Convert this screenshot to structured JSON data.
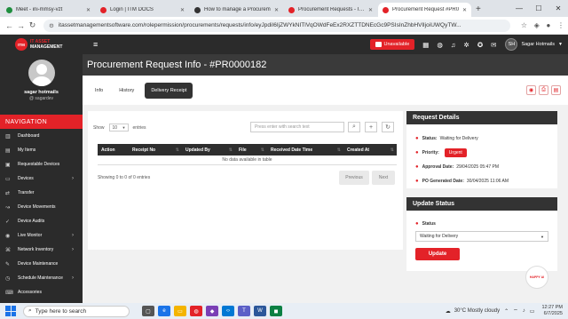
{
  "browser": {
    "tabs": [
      {
        "title": "Meet - ini-mmsy-vzt",
        "color": "#1e8e3e",
        "active": false
      },
      {
        "title": "Login | ITM DOCS",
        "color": "#e32228",
        "active": false
      },
      {
        "title": "How to manage a Procurem",
        "color": "#333333",
        "active": false
      },
      {
        "title": "Procurement Requests - ITM",
        "color": "#e32228",
        "active": false
      },
      {
        "title": "Procurement Request #PR0",
        "color": "#e32228",
        "active": true
      }
    ],
    "url": "itassetmanagementsoftware.com/rolepermission/procurements/requests/info/eyJpdiI6IjZWYkNITlVqOWdFeEx2RXZTTDNEcGc9PSIsInZhbHVlIjoiUWQyTW..."
  },
  "app": {
    "logo_mark": "ITM",
    "logo_line1": "IT ASSET",
    "logo_line2": "MANAGEMENT",
    "status_button": "Unavailable",
    "user_initials": "SH",
    "user_name": "Sagar Hotmails"
  },
  "sidebar": {
    "profile_name": "sagar hotmails",
    "profile_handle": "@ sagardev",
    "nav_heading": "NAVIGATION",
    "items": [
      {
        "label": "Dashboard",
        "icon": "dashboard-icon",
        "arrow": false
      },
      {
        "label": "My Items",
        "icon": "items-icon",
        "arrow": false
      },
      {
        "label": "Requestable Devices",
        "icon": "device-icon",
        "arrow": false
      },
      {
        "label": "Devices",
        "icon": "devices-icon",
        "arrow": true
      },
      {
        "label": "Transfer",
        "icon": "transfer-icon",
        "arrow": false
      },
      {
        "label": "Device Movements",
        "icon": "movements-icon",
        "arrow": false
      },
      {
        "label": "Device Audits",
        "icon": "audit-icon",
        "arrow": false
      },
      {
        "label": "Live Monitor",
        "icon": "monitor-icon",
        "arrow": true
      },
      {
        "label": "Network Inventory",
        "icon": "network-icon",
        "arrow": true
      },
      {
        "label": "Device Maintenance",
        "icon": "maintenance-icon",
        "arrow": false
      },
      {
        "label": "Schedule Maintenance",
        "icon": "schedule-icon",
        "arrow": true
      },
      {
        "label": "Accessories",
        "icon": "accessories-icon",
        "arrow": false
      }
    ]
  },
  "page": {
    "title": "Procurement Request Info - #PR0000182",
    "tabs": [
      "Info",
      "History",
      "Delivery Receipt"
    ],
    "active_tab": "Delivery Receipt"
  },
  "table": {
    "show_label": "Show",
    "entries_value": "10",
    "entries_label": "entries",
    "search_placeholder": "Press enter with search text",
    "columns": [
      "Action",
      "Receipt No",
      "Updated By",
      "File",
      "Received Date Time",
      "Created At"
    ],
    "empty_text": "No data available in table",
    "showing_text": "Showing 0 to 0 of 0 entries",
    "prev_label": "Previous",
    "next_label": "Next"
  },
  "request_details": {
    "heading": "Request Details",
    "status_label": "Status:",
    "status_value": "Waiting for Delivery",
    "priority_label": "Priority:",
    "priority_value": "Urgent",
    "approval_label": "Approval Date:",
    "approval_value": "29/04/2025 05:47 PM",
    "po_label": "PO Generated Date:",
    "po_value": "30/04/2025 11:06 AM"
  },
  "update_status": {
    "heading": "Update Status",
    "status_label": "Status",
    "status_value": "Waiting for Delivery",
    "button": "Update"
  },
  "mascot_text": "HAPPY AI",
  "taskbar": {
    "search_placeholder": "Type here to search",
    "weather": "30°C  Mostly cloudy",
    "time": "12:27 PM",
    "date": "6/7/2025"
  }
}
